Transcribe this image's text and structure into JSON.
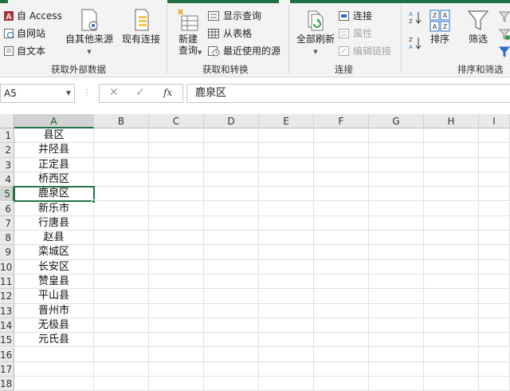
{
  "ribbon": {
    "groups": [
      {
        "name": "get_external",
        "label": "获取外部数据"
      },
      {
        "name": "get_transform",
        "label": "获取和转换"
      },
      {
        "name": "connections",
        "label": "连接"
      },
      {
        "name": "sort_filter",
        "label": "排序和筛选"
      }
    ],
    "access_label": "自 Access",
    "web_label": "自网站",
    "text_label": "自文本",
    "other_sources_label": "自其他来源",
    "existing_conn_label": "现有连接",
    "new_query_label1": "新建",
    "new_query_label2": "查询",
    "show_queries_label": "显示查询",
    "from_table_label": "从表格",
    "recent_sources_label": "最近使用的源",
    "refresh_all_label": "全部刷新",
    "connections_label": "连接",
    "properties_label": "属性",
    "edit_links_label": "编辑链接",
    "sort_label": "排序",
    "filter_label": "筛选"
  },
  "formula_bar": {
    "name_box": "A5",
    "formula": "鹿泉区",
    "fx": "fx"
  },
  "grid": {
    "columns": [
      "A",
      "B",
      "C",
      "D",
      "E",
      "F",
      "G",
      "H",
      "I"
    ],
    "rows": [
      "1",
      "2",
      "3",
      "4",
      "5",
      "6",
      "7",
      "8",
      "9",
      "10",
      "11",
      "12",
      "13",
      "14",
      "15",
      "16",
      "17",
      "18"
    ],
    "column_a": [
      "县区",
      "井陉县",
      "正定县",
      "桥西区",
      "鹿泉区",
      "新乐市",
      "行唐县",
      "赵县",
      "栾城区",
      "长安区",
      "赞皇县",
      "平山县",
      "晋州市",
      "无极县",
      "元氏县",
      "",
      "",
      ""
    ],
    "selected_cell": "A5"
  },
  "colors": {
    "accent": "#217346",
    "ribbon_bg": "#f3f3f3"
  }
}
